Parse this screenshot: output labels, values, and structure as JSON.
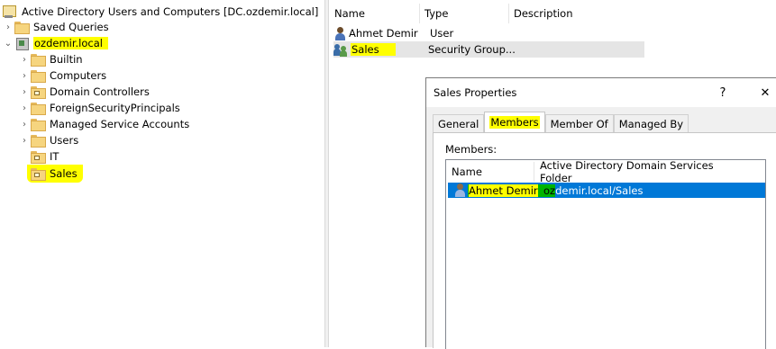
{
  "tree": {
    "root_label": "Active Directory Users and Computers [DC.ozdemir.local]",
    "saved_queries": "Saved Queries",
    "domain": "ozdemir.local",
    "children": [
      "Builtin",
      "Computers",
      "Domain Controllers",
      "ForeignSecurityPrincipals",
      "Managed Service Accounts",
      "Users",
      "IT",
      "Sales"
    ]
  },
  "list": {
    "columns": [
      "Name",
      "Type",
      "Description"
    ],
    "rows": [
      {
        "name": "Ahmet Demir",
        "type": "User",
        "icon": "user-icon"
      },
      {
        "name": "Sales",
        "type": "Security Group...",
        "icon": "group-icon"
      }
    ]
  },
  "dialog": {
    "title": "Sales Properties",
    "help": "?",
    "close": "✕",
    "tabs": [
      "General",
      "Members",
      "Member Of",
      "Managed By"
    ],
    "members_label": "Members:",
    "columns": [
      "Name",
      "Active Directory Domain Services Folder"
    ],
    "member": {
      "name": "Ahmet Demir",
      "folder_prefix": "oz",
      "folder_rest": "demir.local/Sales"
    }
  },
  "colors": {
    "highlight": "#ffff00",
    "selection": "#0078d7",
    "marker_green": "#00b400"
  }
}
